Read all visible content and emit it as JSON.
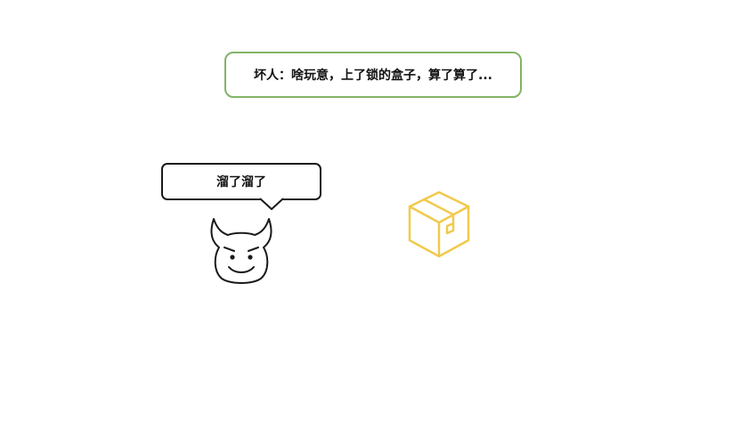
{
  "caption": {
    "text": "坏人：啥玩意，上了锁的盒子，算了算了..."
  },
  "speech_bubble": {
    "text": "溜了溜了"
  },
  "colors": {
    "caption_border": "#82b366",
    "box_stroke": "#f2c94c",
    "outline": "#1a1a1a"
  },
  "icons": {
    "character": "devil-face-icon",
    "object": "cardboard-box-icon"
  }
}
